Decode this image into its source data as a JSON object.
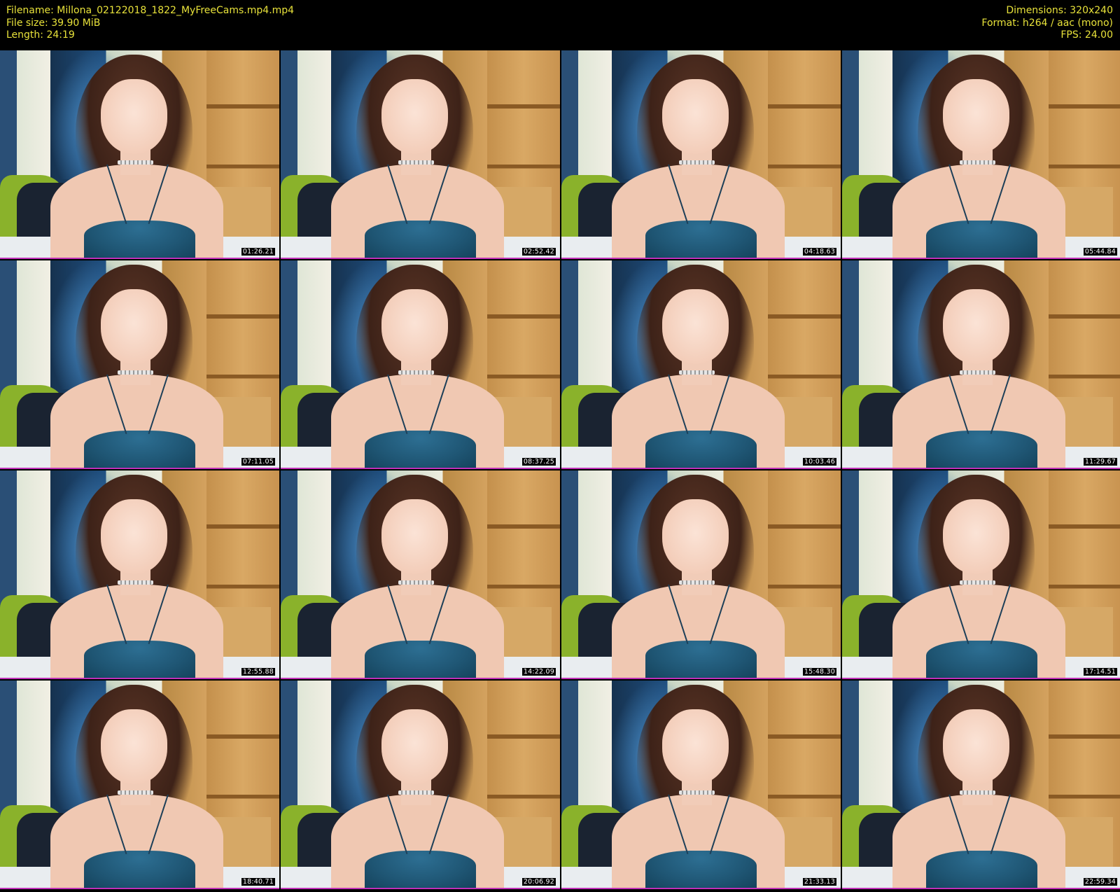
{
  "header": {
    "filename": "Filename: Millona_02122018_1822_MyFreeCams.mp4.mp4",
    "file_size": "File size: 39.90 MiB",
    "length": "Length: 24:19",
    "dimensions": "Dimensions: 320x240",
    "format": "Format: h264 / aac (mono)",
    "fps": "FPS: 24.00"
  },
  "colors": {
    "text": "#e8e23a",
    "background": "#000000",
    "thumb_border": "#c02fb8",
    "timestamp_text": "#ffffff"
  },
  "thumbnails": [
    {
      "timestamp": "01:26.21"
    },
    {
      "timestamp": "02:52.42"
    },
    {
      "timestamp": "04:18.63"
    },
    {
      "timestamp": "05:44.84"
    },
    {
      "timestamp": "07:11.05"
    },
    {
      "timestamp": "08:37.25"
    },
    {
      "timestamp": "10:03.46"
    },
    {
      "timestamp": "11:29.67"
    },
    {
      "timestamp": "12:55.88"
    },
    {
      "timestamp": "14:22.09"
    },
    {
      "timestamp": "15:48.30"
    },
    {
      "timestamp": "17:14.51"
    },
    {
      "timestamp": "18:40.71"
    },
    {
      "timestamp": "20:06.92"
    },
    {
      "timestamp": "21:33.13"
    },
    {
      "timestamp": "22:59.34"
    }
  ]
}
